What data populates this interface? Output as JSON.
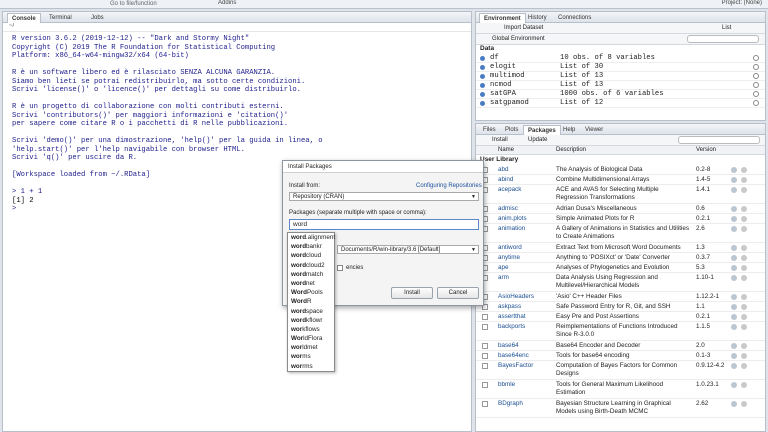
{
  "topbar": {
    "goto_placeholder": "Go to file/function",
    "addins": "Addins",
    "project": "Project: (None)"
  },
  "console": {
    "tabs": [
      "Console",
      "Terminal",
      "Jobs"
    ],
    "path": "~/",
    "lines": [
      "R version 3.6.2 (2019-12-12) -- \"Dark and Stormy Night\"",
      "Copyright (C) 2019 The R Foundation for Statistical Computing",
      "Platform: x86_64-w64-mingw32/x64 (64-bit)",
      "",
      "R è un software libero ed è rilasciato SENZA ALCUNA GARANZIA.",
      "Siamo ben lieti se potrai redistribuirlo, ma sotto certe condizioni.",
      "Scrivi 'license()' o 'licence()' per dettagli su come distribuirlo.",
      "",
      "R è un progetto di collaborazione con molti contributi esterni.",
      "Scrivi 'contributors()' per maggiori informazioni e 'citation()'",
      "per sapere come citare R o i pacchetti di R nelle pubblicazioni.",
      "",
      "Scrivi 'demo()' per una dimostrazione, 'help()' per la guida in linea, o",
      "'help.start()' per l'help navigabile con browser HTML.",
      "Scrivi 'q()' per uscire da R.",
      "",
      "[Workspace loaded from ~/.RData]",
      "",
      "> 1 + 1",
      "[1] 2",
      "> "
    ]
  },
  "environment": {
    "tabs": [
      "Environment",
      "History",
      "Connections"
    ],
    "import_label": "Import Dataset",
    "list_label": "List",
    "scope": "Global Environment",
    "section": "Data",
    "rows": [
      {
        "name": "df",
        "value": "10 obs. of 8 variables"
      },
      {
        "name": "elogit",
        "value": "List of 30"
      },
      {
        "name": "multimod",
        "value": "List of 13"
      },
      {
        "name": "ncmod",
        "value": "List of 13"
      },
      {
        "name": "satGPA",
        "value": "1000 obs. of 6 variables"
      },
      {
        "name": "satgpamod",
        "value": "List of 12"
      }
    ]
  },
  "packages": {
    "tabs": [
      "Files",
      "Plots",
      "Packages",
      "Help",
      "Viewer"
    ],
    "install_label": "Install",
    "update_label": "Update",
    "col_name": "Name",
    "col_desc": "Description",
    "col_version": "Version",
    "section": "User Library",
    "rows": [
      {
        "name": "abd",
        "desc": "The Analysis of Biological Data",
        "ver": "0.2-8",
        "h": 1
      },
      {
        "name": "abind",
        "desc": "Combine Multidimensional Arrays",
        "ver": "1.4-5",
        "h": 1
      },
      {
        "name": "acepack",
        "desc": "ACE and AVAS for Selecting Multiple Regression Transformations",
        "ver": "1.4.1",
        "h": 2
      },
      {
        "name": "admisc",
        "desc": "Adrian Dusa's Miscellaneous",
        "ver": "0.6",
        "h": 1
      },
      {
        "name": "anim.plots",
        "desc": "Simple Animated Plots for R",
        "ver": "0.2.1",
        "h": 1
      },
      {
        "name": "animation",
        "desc": "A Gallery of Animations in Statistics and Utilities to Create Animations",
        "ver": "2.6",
        "h": 2
      },
      {
        "name": "antiword",
        "desc": "Extract Text from Microsoft Word Documents",
        "ver": "1.3",
        "h": 1
      },
      {
        "name": "anytime",
        "desc": "Anything to 'POSIXct' or 'Date' Converter",
        "ver": "0.3.7",
        "h": 1
      },
      {
        "name": "ape",
        "desc": "Analyses of Phylogenetics and Evolution",
        "ver": "5.3",
        "h": 1
      },
      {
        "name": "arm",
        "desc": "Data Analysis Using Regression and Multilevel/Hierarchical Models",
        "ver": "1.10-1",
        "h": 2
      },
      {
        "name": "AsioHeaders",
        "desc": "'Asio' C++ Header Files",
        "ver": "1.12.2-1",
        "h": 1
      },
      {
        "name": "askpass",
        "desc": "Safe Password Entry for R, Git, and SSH",
        "ver": "1.1",
        "h": 1
      },
      {
        "name": "assertthat",
        "desc": "Easy Pre and Post Assertions",
        "ver": "0.2.1",
        "h": 1
      },
      {
        "name": "backports",
        "desc": "Reimplementations of Functions Introduced Since R-3.0.0",
        "ver": "1.1.5",
        "h": 2
      },
      {
        "name": "base64",
        "desc": "Base64 Encoder and Decoder",
        "ver": "2.0",
        "h": 1
      },
      {
        "name": "base64enc",
        "desc": "Tools for base64 encoding",
        "ver": "0.1-3",
        "h": 1
      },
      {
        "name": "BayesFactor",
        "desc": "Computation of Bayes Factors for Common Designs",
        "ver": "0.9.12-4.2",
        "h": 2
      },
      {
        "name": "bbmle",
        "desc": "Tools for General Maximum Likelihood Estimation",
        "ver": "1.0.23.1",
        "h": 2
      },
      {
        "name": "BDgraph",
        "desc": "Bayesian Structure Learning in Graphical Models using Birth-Death MCMC",
        "ver": "2.62",
        "h": 2
      }
    ]
  },
  "dialog": {
    "title": "Install Packages",
    "install_from_label": "Install from:",
    "configuring_link": "Configuring Repositories",
    "repo_value": "Repository (CRAN)",
    "packages_label": "Packages (separate multiple with space or comma):",
    "packages_value": "word",
    "library_value": "Documents/R/win-library/3.6 [Default]",
    "deps_label": "encies",
    "install_button": "Install",
    "cancel_button": "Cancel"
  },
  "autocomplete": [
    {
      "b": "word",
      "r": ".alignment"
    },
    {
      "b": "word",
      "r": "bankr"
    },
    {
      "b": "word",
      "r": "cloud"
    },
    {
      "b": "word",
      "r": "cloud2"
    },
    {
      "b": "word",
      "r": "match"
    },
    {
      "b": "word",
      "r": "net"
    },
    {
      "b": "Word",
      "r": "Pools"
    },
    {
      "b": "Word",
      "r": "R"
    },
    {
      "b": "word",
      "r": "space"
    },
    {
      "b": "word",
      "r": "kflowr"
    },
    {
      "b": "wor",
      "r": "kflows"
    },
    {
      "b": "Wor",
      "r": "ldFlora"
    },
    {
      "b": "wor",
      "r": "ldmet"
    },
    {
      "b": "wor",
      "r": "ms"
    },
    {
      "b": "wor",
      "r": "rms"
    }
  ]
}
